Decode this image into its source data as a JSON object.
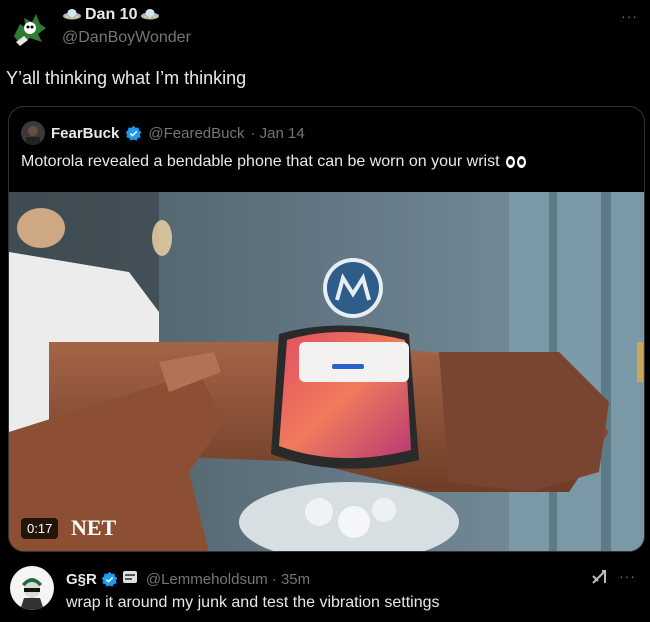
{
  "main_tweet": {
    "display_name": "Dan 10",
    "handle": "@DanBoyWonder",
    "text": "Y’all thinking what I’m thinking",
    "more_label": "···"
  },
  "quoted_tweet": {
    "display_name": "FearBuck",
    "handle": "@FearedBuck",
    "date": "· Jan 14",
    "text": "Motorola revealed a bendable phone that can be worn on your wrist",
    "video": {
      "timestamp": "0:17",
      "watermark": "NET"
    }
  },
  "reply": {
    "display_name": "G§R",
    "handle": "@Lemmeholdsum",
    "time": "· 35m",
    "text": "wrap it around my junk and test the vibration settings",
    "more_label": "···"
  },
  "colors": {
    "background": "#000000",
    "primary_text": "#e7e9ea",
    "secondary_text": "#71767b",
    "verified_blue": "#1d9bf0",
    "border": "#2f3336"
  }
}
